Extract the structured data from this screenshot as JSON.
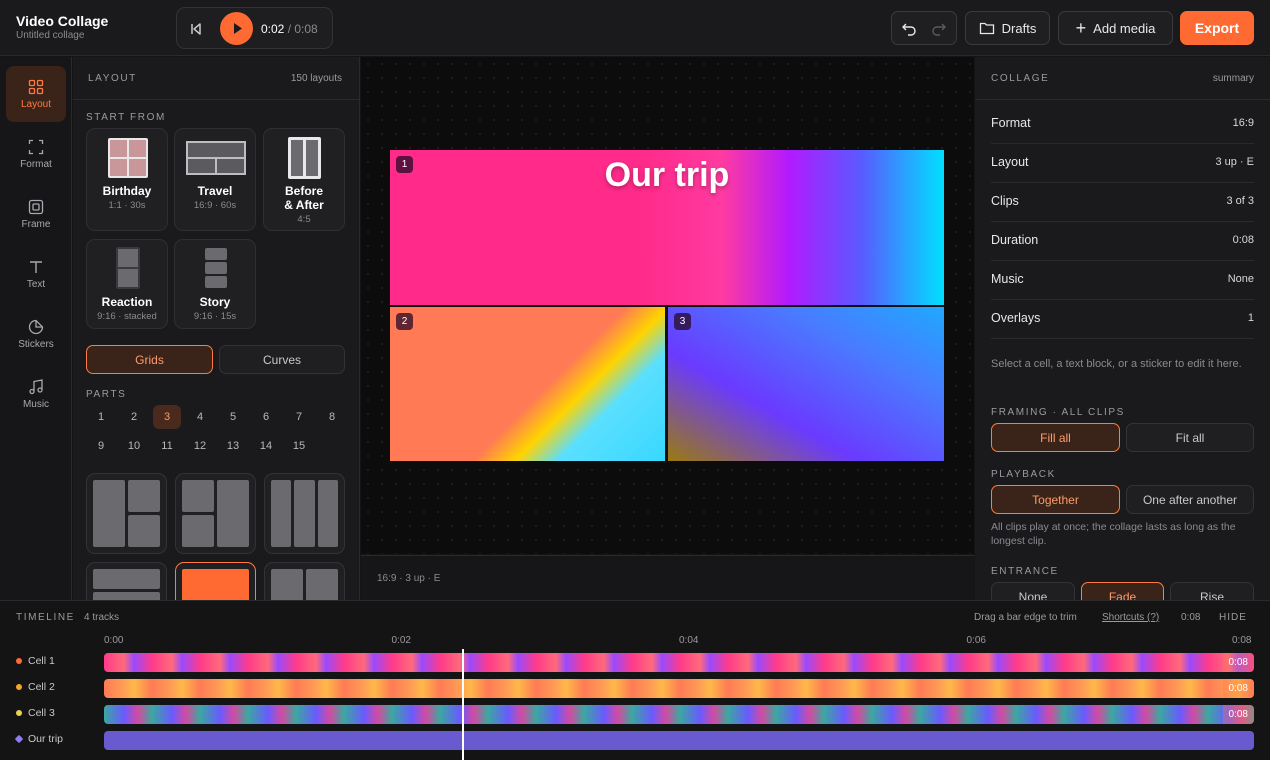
{
  "app": {
    "title": "Video Collage",
    "subtitle": "Untitled collage"
  },
  "player": {
    "current": "0:02",
    "total": " / 0:08"
  },
  "toolbar": {
    "drafts": "Drafts",
    "add_media": "Add media",
    "export": "Export"
  },
  "rail": [
    {
      "label": "Layout",
      "icon": "grid-icon"
    },
    {
      "label": "Format",
      "icon": "format-icon"
    },
    {
      "label": "Frame",
      "icon": "frame-icon"
    },
    {
      "label": "Text",
      "icon": "text-icon"
    },
    {
      "label": "Stickers",
      "icon": "sticker-icon"
    },
    {
      "label": "Music",
      "icon": "music-icon"
    }
  ],
  "layout_panel": {
    "title": "LAYOUT",
    "count": "150 layouts",
    "start_from": "START FROM",
    "templates": [
      {
        "name": "Birthday",
        "meta": "1:1 · 30s"
      },
      {
        "name": "Travel",
        "meta": "16:9 · 60s"
      },
      {
        "name": "Before\n& After",
        "meta": "4:5"
      },
      {
        "name": "Reaction",
        "meta": "9:16 · stacked"
      },
      {
        "name": "Story",
        "meta": "9:16 · 15s"
      }
    ],
    "tabs": [
      "Grids",
      "Curves"
    ],
    "parts_label": "PARTS",
    "parts": [
      "1",
      "2",
      "3",
      "4",
      "5",
      "6",
      "7",
      "8",
      "9",
      "10",
      "11",
      "12",
      "13",
      "14",
      "15"
    ],
    "selected_part": "3"
  },
  "canvas": {
    "title_text": "Our trip",
    "cells": [
      "1",
      "2",
      "3"
    ],
    "footer": "16:9 · 3 up · E"
  },
  "collage_panel": {
    "title": "COLLAGE",
    "summary": "summary",
    "rows": [
      {
        "k": "Format",
        "v": "16:9"
      },
      {
        "k": "Layout",
        "v": "3 up · E"
      },
      {
        "k": "Clips",
        "v": "3 of 3"
      },
      {
        "k": "Duration",
        "v": "0:08"
      },
      {
        "k": "Music",
        "v": "None"
      },
      {
        "k": "Overlays",
        "v": "1"
      }
    ],
    "hint": "Select a cell, a text block, or a sticker to edit it here.",
    "framing_label": "FRAMING · ALL CLIPS",
    "framing": [
      "Fill all",
      "Fit all"
    ],
    "playback_label": "PLAYBACK",
    "playback": [
      "Together",
      "One after another"
    ],
    "playback_note": "All clips play at once; the collage lasts as long as the longest clip.",
    "entrance_label": "ENTRANCE",
    "entrance": [
      "None",
      "Fade",
      "Rise"
    ]
  },
  "timeline": {
    "label": "TIMELINE",
    "tracks_count": "4 tracks",
    "hint": "Drag a bar edge to trim",
    "shortcuts": "Shortcuts (?)",
    "total": "0:08",
    "hide": "HIDE",
    "ticks": [
      "0:00",
      "0:02",
      "0:04",
      "0:06",
      "0:08"
    ],
    "tracks": [
      {
        "name": "Cell 1",
        "end": "0:08",
        "color": "#ff6a33"
      },
      {
        "name": "Cell 2",
        "end": "0:08",
        "color": "#f5a623"
      },
      {
        "name": "Cell 3",
        "end": "0:08",
        "color": "#e8d44d"
      },
      {
        "name": "Our trip",
        "end": "",
        "color": "#8b7ff0"
      }
    ],
    "playhead_fraction": 0.3125
  },
  "colors": {
    "accent": "#ff6a33"
  }
}
